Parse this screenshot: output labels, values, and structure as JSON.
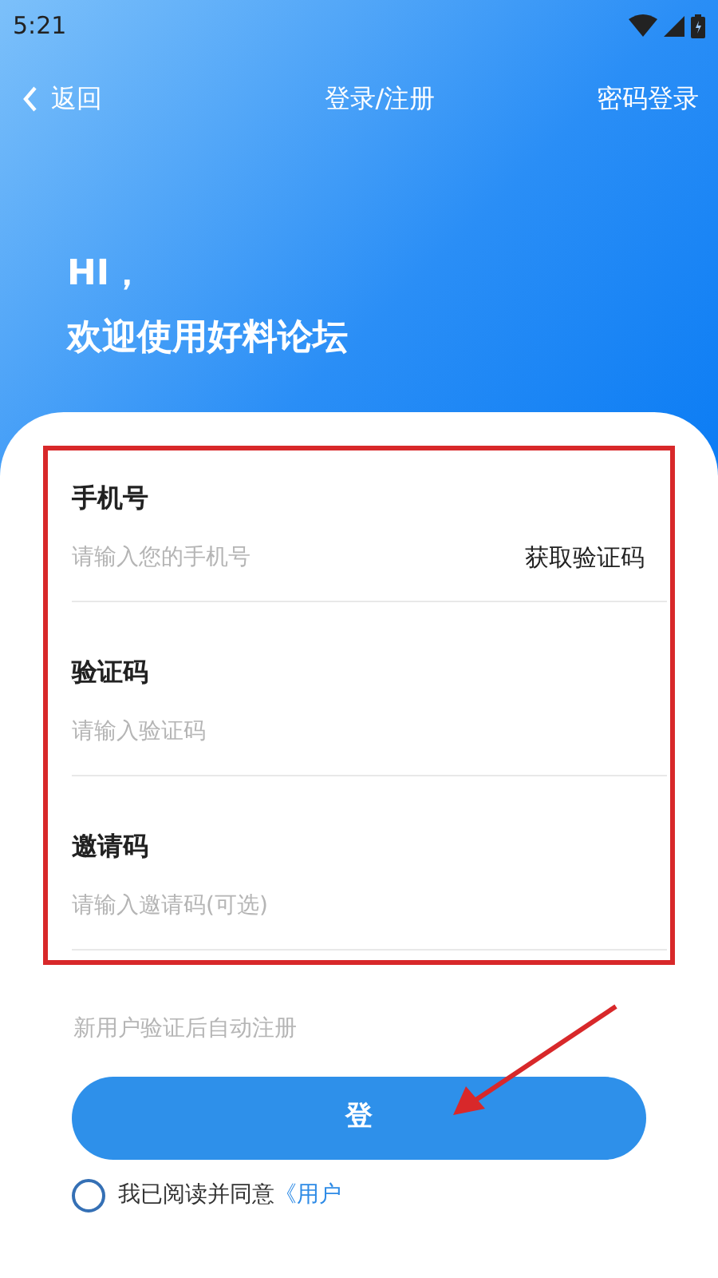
{
  "status_bar": {
    "time": "5:21"
  },
  "nav": {
    "back": "返回",
    "title": "登录/注册",
    "action": "密码登录"
  },
  "greeting": {
    "line_1": "HI，",
    "line_2": "欢迎使用好料论坛"
  },
  "fields": [
    {
      "label": "手机号",
      "placeholder": "请输入您的手机号",
      "action": "获取验证码"
    },
    {
      "label": "验证码",
      "placeholder": "请输入验证码"
    },
    {
      "label": "邀请码",
      "placeholder": "请输入邀请码(可选)"
    }
  ],
  "note": "新用户验证后自动注册",
  "login_button": "登",
  "agreement": {
    "checked": false,
    "text": "我已阅读并同意",
    "link": "《用户"
  }
}
